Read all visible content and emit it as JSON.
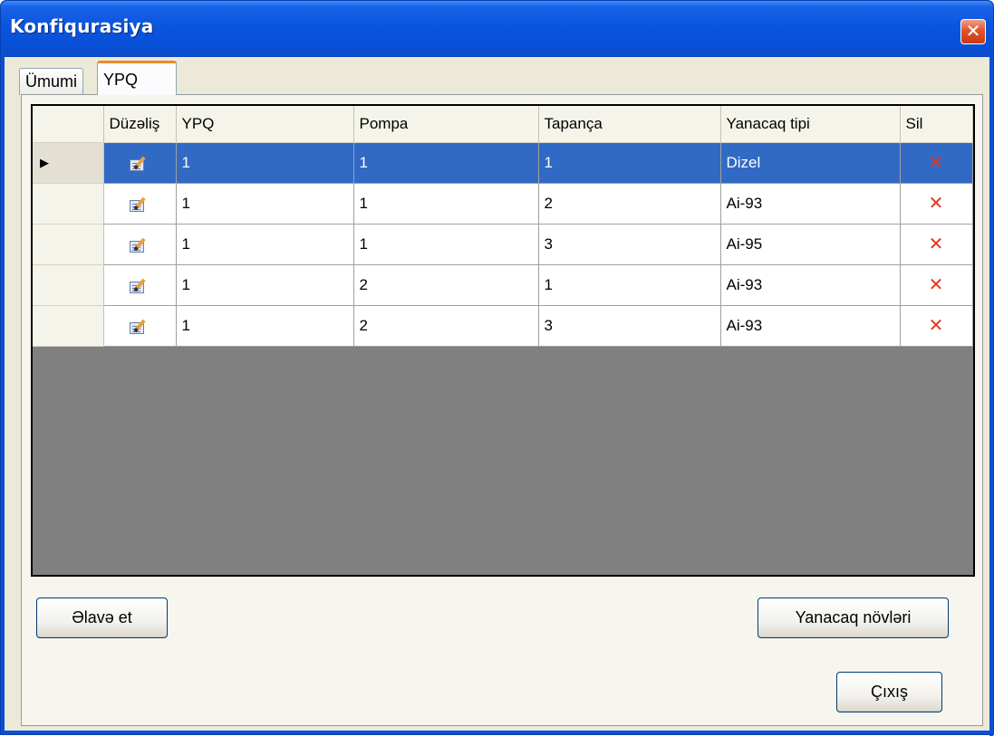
{
  "window": {
    "title": "Konfiqurasiya",
    "close_glyph": "✕"
  },
  "tabs": [
    {
      "label": "Ümumi",
      "active": false
    },
    {
      "label": "YPQ",
      "active": true
    }
  ],
  "grid": {
    "columns": [
      "Düzəliş",
      "YPQ",
      "Pompa",
      "Tapança",
      "Yanacaq tipi",
      "Sil"
    ],
    "edit_icon": "edit-icon",
    "delete_icon": "delete-icon",
    "delete_glyph": "✕",
    "selected_row_marker": "▶",
    "rows": [
      {
        "ypq": "1",
        "pompa": "1",
        "tapanca": "1",
        "yanacaq_tipi": "Dizel",
        "selected": true
      },
      {
        "ypq": "1",
        "pompa": "1",
        "tapanca": "2",
        "yanacaq_tipi": "Ai-93",
        "selected": false
      },
      {
        "ypq": "1",
        "pompa": "1",
        "tapanca": "3",
        "yanacaq_tipi": "Ai-95",
        "selected": false
      },
      {
        "ypq": "1",
        "pompa": "2",
        "tapanca": "1",
        "yanacaq_tipi": "Ai-93",
        "selected": false
      },
      {
        "ypq": "1",
        "pompa": "2",
        "tapanca": "3",
        "yanacaq_tipi": "Ai-93",
        "selected": false
      }
    ]
  },
  "buttons": {
    "add_label": "Əlavə et",
    "fuel_types_label": "Yanacaq növləri",
    "exit_label": "Çıxış"
  },
  "colors": {
    "titlebar": "#0a54df",
    "selection": "#316ac5",
    "grid_background": "#808080",
    "delete_icon": "#e4361c",
    "active_tab_accent": "#e68b2c"
  }
}
